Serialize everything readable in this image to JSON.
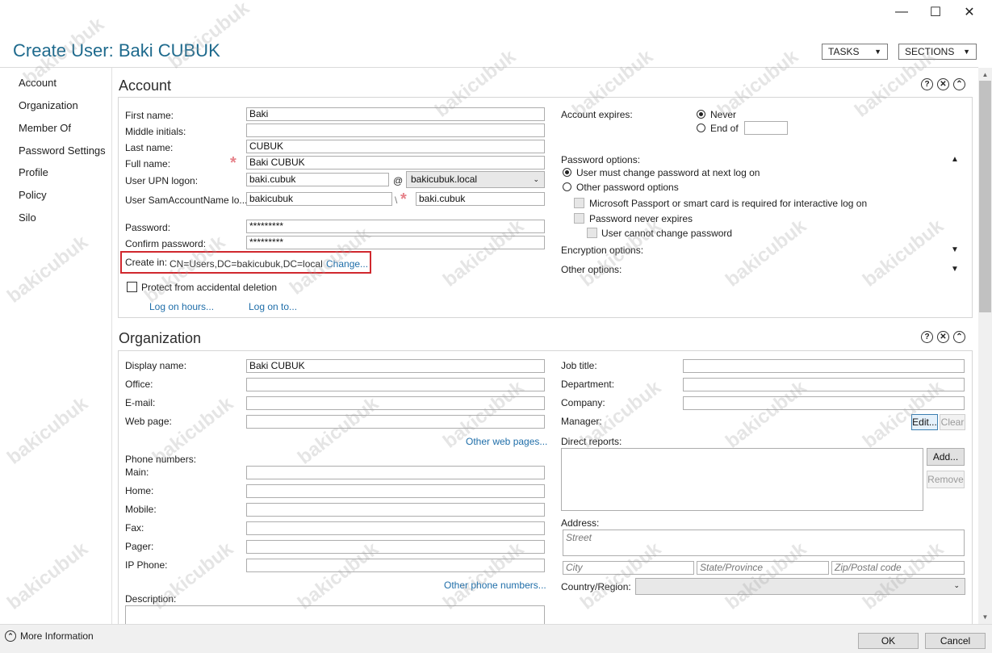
{
  "window": {
    "title": "Create User: Baki CUBUK",
    "minimize": "—",
    "maximize": "☐",
    "close": "✕"
  },
  "header": {
    "tasks_label": "TASKS",
    "sections_label": "SECTIONS"
  },
  "nav": {
    "items": [
      "Account",
      "Organization",
      "Member Of",
      "Password Settings",
      "Profile",
      "Policy",
      "Silo"
    ]
  },
  "account": {
    "heading": "Account",
    "first_name_label": "First name:",
    "first_name": "Baki",
    "middle_initials_label": "Middle initials:",
    "middle_initials": "",
    "last_name_label": "Last name:",
    "last_name": "CUBUK",
    "full_name_label": "Full name:",
    "full_name": "Baki CUBUK",
    "upn_label": "User UPN logon:",
    "upn_value": "baki.cubuk",
    "at": "@",
    "upn_domain": "bakicubuk.local",
    "sam_label": "User SamAccountName lo...",
    "sam_domain": "bakicubuk",
    "backslash": "\\",
    "sam_value": "baki.cubuk",
    "password_label": "Password:",
    "password": "*********",
    "confirm_label": "Confirm password:",
    "confirm": "*********",
    "create_in_label": "Create in:",
    "create_in_value": "CN=Users,DC=bakicubuk,DC=local",
    "change_link": "Change...",
    "protect_label": "Protect from accidental deletion",
    "logon_hours_link": "Log on hours...",
    "logon_to_link": "Log on to...",
    "expires_label": "Account expires:",
    "never_label": "Never",
    "end_of_label": "End of",
    "end_of_value": "",
    "pw_options_label": "Password options:",
    "must_change_label": "User must change password at next log on",
    "other_pw_label": "Other password options",
    "passport_label": "Microsoft Passport or smart card is required for interactive log on",
    "never_expires_label": "Password never expires",
    "cannot_change_label": "User cannot change password",
    "encryption_label": "Encryption options:",
    "other_options_label": "Other options:"
  },
  "organization": {
    "heading": "Organization",
    "display_name_label": "Display name:",
    "display_name": "Baki CUBUK",
    "office_label": "Office:",
    "email_label": "E-mail:",
    "webpage_label": "Web page:",
    "other_web_link": "Other web pages...",
    "phone_label": "Phone numbers:",
    "main_label": "Main:",
    "home_label": "Home:",
    "mobile_label": "Mobile:",
    "fax_label": "Fax:",
    "pager_label": "Pager:",
    "ip_phone_label": "IP Phone:",
    "other_phone_link": "Other phone numbers...",
    "description_label": "Description:",
    "job_title_label": "Job title:",
    "department_label": "Department:",
    "company_label": "Company:",
    "manager_label": "Manager:",
    "edit_btn": "Edit...",
    "clear_btn": "Clear",
    "direct_reports_label": "Direct reports:",
    "add_btn": "Add...",
    "remove_btn": "Remove",
    "address_label": "Address:",
    "street_ph": "Street",
    "city_ph": "City",
    "state_ph": "State/Province",
    "zip_ph": "Zip/Postal code",
    "country_label": "Country/Region:"
  },
  "footer": {
    "more_info": "More Information",
    "ok": "OK",
    "cancel": "Cancel"
  },
  "watermark": "bakicubuk",
  "colors": {
    "title": "#1e6a8d",
    "link": "#1f6ea9",
    "highlight": "#d0282e",
    "required": "#e6828a"
  }
}
